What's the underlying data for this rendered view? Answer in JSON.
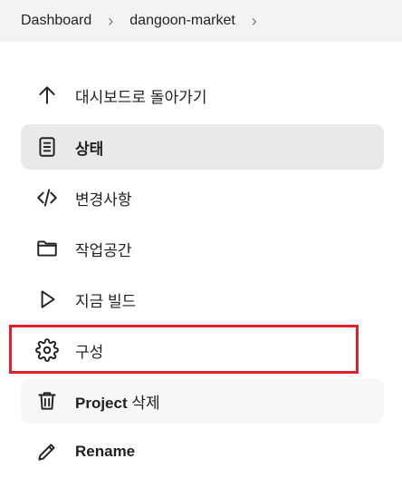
{
  "breadcrumb": {
    "items": [
      {
        "label": "Dashboard"
      },
      {
        "label": "dangoon-market"
      }
    ]
  },
  "nav": {
    "items": [
      {
        "label": "대시보드로 돌아가기",
        "icon": "arrow-up-icon"
      },
      {
        "label": "상태",
        "icon": "document-icon",
        "state": "active"
      },
      {
        "label": "변경사항",
        "icon": "code-icon"
      },
      {
        "label": "작업공간",
        "icon": "folder-icon"
      },
      {
        "label": "지금 빌드",
        "icon": "play-icon"
      },
      {
        "label": "구성",
        "icon": "gear-icon",
        "highlighted": true
      },
      {
        "label_en": "Project",
        "label_ko": " 삭제",
        "icon": "trash-icon"
      },
      {
        "label": "Rename",
        "icon": "pencil-icon"
      }
    ]
  },
  "colors": {
    "highlight": "#e0202a",
    "breadcrumb_bg": "#f3f3f3",
    "active_bg": "#e9e9e9"
  }
}
